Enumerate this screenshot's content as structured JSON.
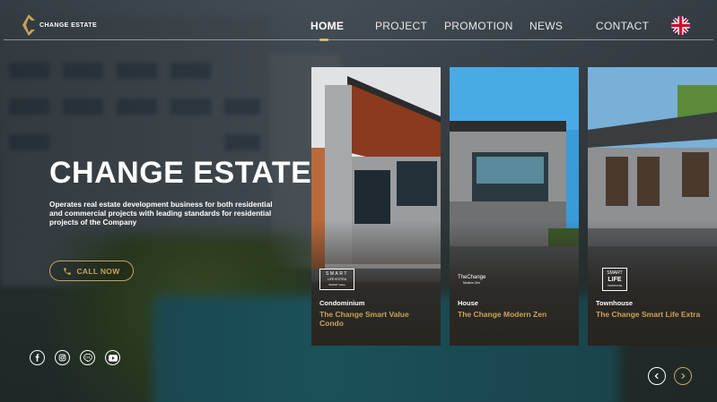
{
  "brand": {
    "name": "CHANGE ESTATE",
    "accent": "#c8a45a"
  },
  "nav": {
    "items": [
      {
        "label": "HOME",
        "active": true
      },
      {
        "label": "PROJECT",
        "active": false
      },
      {
        "label": "PROMOTION",
        "active": false
      },
      {
        "label": "NEWS",
        "active": false
      },
      {
        "label": "CONTACT",
        "active": false
      }
    ],
    "language_icon": "uk-flag-icon"
  },
  "hero": {
    "title": "CHANGE ESTATE",
    "description": "Operates real estate development business for both residential and commercial projects with leading standards for residential projects of the Company",
    "call_label": "CALL NOW",
    "call_icon": "phone-icon"
  },
  "cards": [
    {
      "category": "Condominium",
      "name": "The Change Smart Value Condo",
      "brand_text": [
        "SMART",
        "LIFE+EXTRA",
        "SMART Value"
      ]
    },
    {
      "category": "House",
      "name": "The Change Modern Zen",
      "brand_text": [
        "TheChange",
        "Modern Zen"
      ]
    },
    {
      "category": "Townhouse",
      "name": "The Change Smart Life Extra",
      "brand_text": [
        "SMART",
        "LIFE",
        "TOWNHOUSE"
      ]
    }
  ],
  "social": [
    "facebook-icon",
    "instagram-icon",
    "line-icon",
    "youtube-icon"
  ],
  "carousel": {
    "prev_icon": "chevron-left-icon",
    "next_icon": "chevron-right-icon"
  }
}
